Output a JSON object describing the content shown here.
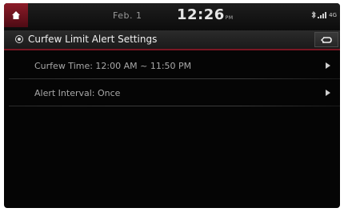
{
  "status_bar": {
    "date": "Feb. 1",
    "time": "12:26",
    "ampm": "PM",
    "status_text": "4G"
  },
  "header": {
    "title": "Curfew Limit Alert Settings"
  },
  "items": [
    {
      "label": "Curfew Time: 12:00 AM ~ 11:50 PM"
    },
    {
      "label": "Alert Interval: Once"
    }
  ],
  "colors": {
    "accent": "#7a1723",
    "home_button": "#8c1b28",
    "background": "#050505"
  },
  "icons": {
    "home": "home-icon",
    "title": "radio-target-icon",
    "back": "back-arrow-icon",
    "item_chevron": "chevron-right-icon"
  }
}
